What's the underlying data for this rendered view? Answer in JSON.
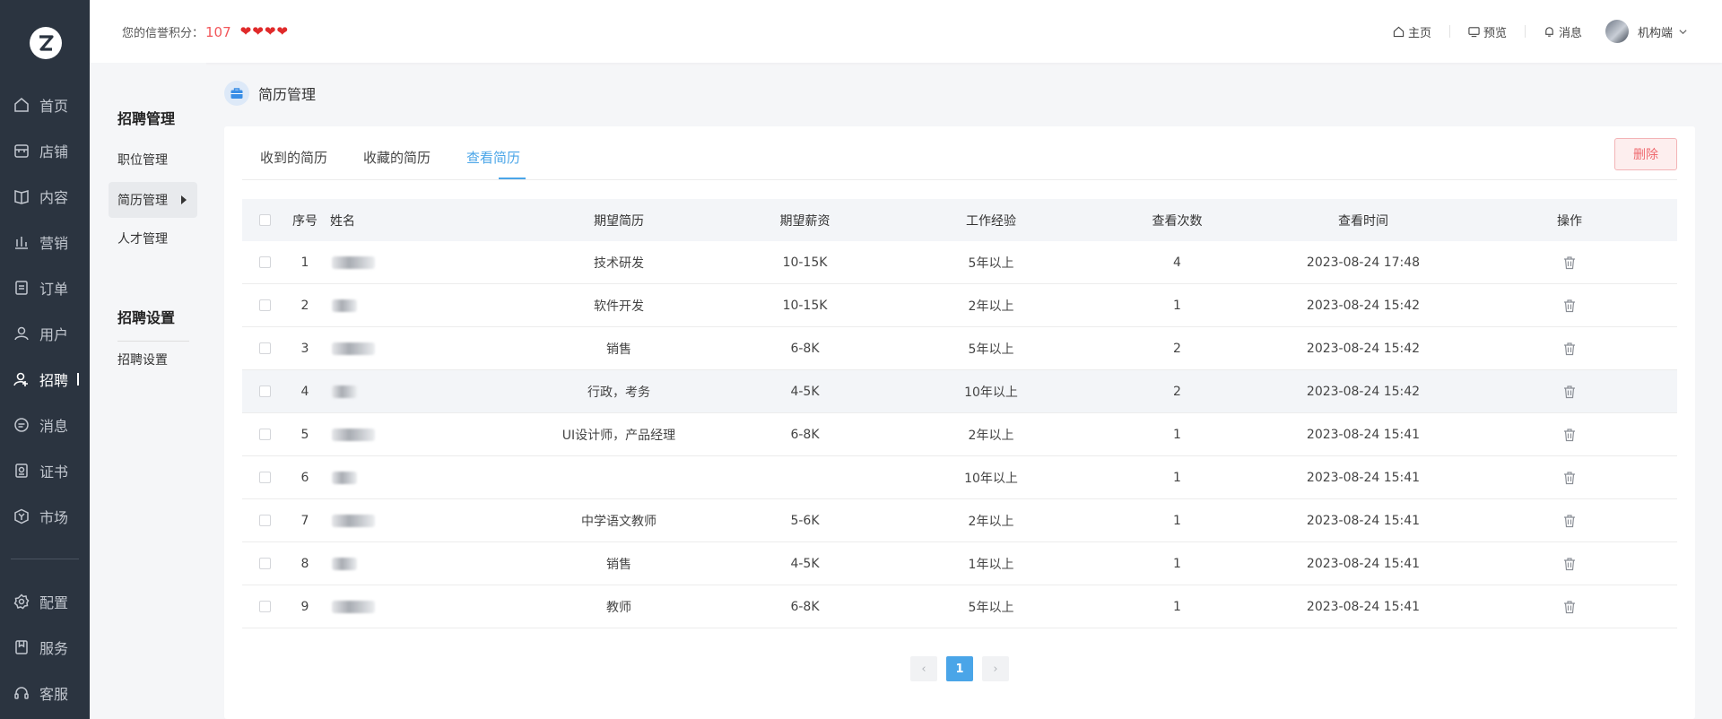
{
  "nav": {
    "items": [
      {
        "label": "首页",
        "icon": "home-icon"
      },
      {
        "label": "店铺",
        "icon": "store-icon"
      },
      {
        "label": "内容",
        "icon": "book-icon"
      },
      {
        "label": "营销",
        "icon": "bar-chart-icon"
      },
      {
        "label": "订单",
        "icon": "order-icon"
      },
      {
        "label": "用户",
        "icon": "user-icon"
      },
      {
        "label": "招聘",
        "icon": "recruit-icon",
        "active": true
      },
      {
        "label": "消息",
        "icon": "chat-icon"
      },
      {
        "label": "证书",
        "icon": "certificate-icon"
      },
      {
        "label": "市场",
        "icon": "market-icon"
      },
      {
        "label": "配置",
        "icon": "settings-icon"
      },
      {
        "label": "服务",
        "icon": "service-icon"
      },
      {
        "label": "客服",
        "icon": "headset-icon"
      }
    ]
  },
  "header": {
    "credit_label": "您的信誉积分：",
    "credit_score": "107",
    "hearts": [
      "❤",
      "❤",
      "❤",
      "❤"
    ],
    "links": {
      "home": "主页",
      "preview": "预览",
      "messages": "消息"
    },
    "user_name": "机构端"
  },
  "subnav": {
    "group1": "招聘管理",
    "items1": [
      "职位管理",
      "简历管理",
      "人才管理"
    ],
    "group2": "招聘设置",
    "items2": [
      "招聘设置"
    ]
  },
  "page": {
    "title": "简历管理"
  },
  "tabs": [
    "收到的简历",
    "收藏的简历",
    "查看简历"
  ],
  "active_tab": "查看简历",
  "delete_label": "删除",
  "table": {
    "headers": [
      "序号",
      "姓名",
      "期望简历",
      "期望薪资",
      "工作经验",
      "查看次数",
      "查看时间",
      "操作"
    ],
    "rows": [
      {
        "idx": "1",
        "resume": "技术研发",
        "salary": "10-15K",
        "exp": "5年以上",
        "count": "4",
        "time": "2023-08-24 17:48"
      },
      {
        "idx": "2",
        "resume": "软件开发",
        "salary": "10-15K",
        "exp": "2年以上",
        "count": "1",
        "time": "2023-08-24 15:42"
      },
      {
        "idx": "3",
        "resume": "销售",
        "salary": "6-8K",
        "exp": "5年以上",
        "count": "2",
        "time": "2023-08-24 15:42"
      },
      {
        "idx": "4",
        "resume": "行政，考务",
        "salary": "4-5K",
        "exp": "10年以上",
        "count": "2",
        "time": "2023-08-24 15:42"
      },
      {
        "idx": "5",
        "resume": "UI设计师，产品经理",
        "salary": "6-8K",
        "exp": "2年以上",
        "count": "1",
        "time": "2023-08-24 15:41"
      },
      {
        "idx": "6",
        "resume": "",
        "salary": "",
        "exp": "10年以上",
        "count": "1",
        "time": "2023-08-24 15:41"
      },
      {
        "idx": "7",
        "resume": "中学语文教师",
        "salary": "5-6K",
        "exp": "2年以上",
        "count": "1",
        "time": "2023-08-24 15:41"
      },
      {
        "idx": "8",
        "resume": "销售",
        "salary": "4-5K",
        "exp": "1年以上",
        "count": "1",
        "time": "2023-08-24 15:41"
      },
      {
        "idx": "9",
        "resume": "教师",
        "salary": "6-8K",
        "exp": "5年以上",
        "count": "1",
        "time": "2023-08-24 15:41"
      }
    ]
  },
  "pagination": {
    "current": "1",
    "prev": "‹",
    "next": "›"
  },
  "colors": {
    "accent": "#4aa5e8",
    "danger": "#ef6a6f",
    "nav_bg": "#2b3440",
    "score": "#f2565a"
  }
}
